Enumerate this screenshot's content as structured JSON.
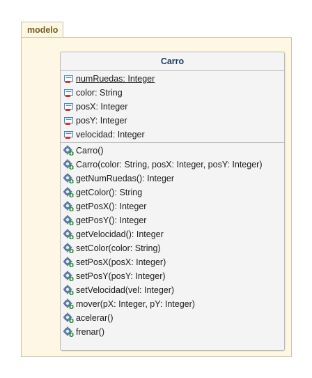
{
  "package": {
    "name": "modelo"
  },
  "class": {
    "name": "Carro",
    "attributes": [
      {
        "text": "numRuedas: Integer",
        "static": true,
        "icon": "private-field-icon"
      },
      {
        "text": "color: String",
        "static": false,
        "icon": "private-field-icon"
      },
      {
        "text": "posX: Integer",
        "static": false,
        "icon": "private-field-icon"
      },
      {
        "text": "posY: Integer",
        "static": false,
        "icon": "private-field-icon"
      },
      {
        "text": "velocidad: Integer",
        "static": false,
        "icon": "private-field-icon"
      }
    ],
    "operations": [
      {
        "text": "Carro()",
        "icon": "public-operation-icon"
      },
      {
        "text": "Carro(color: String, posX: Integer, posY: Integer)",
        "icon": "public-operation-icon"
      },
      {
        "text": "getNumRuedas(): Integer",
        "icon": "public-operation-icon"
      },
      {
        "text": "getColor(): String",
        "icon": "public-operation-icon"
      },
      {
        "text": "getPosX(): Integer",
        "icon": "public-operation-icon"
      },
      {
        "text": "getPosY(): Integer",
        "icon": "public-operation-icon"
      },
      {
        "text": "getVelocidad(): Integer",
        "icon": "public-operation-icon"
      },
      {
        "text": "setColor(color: String)",
        "icon": "public-operation-icon"
      },
      {
        "text": "setPosX(posX: Integer)",
        "icon": "public-operation-icon"
      },
      {
        "text": "setPosY(posY: Integer)",
        "icon": "public-operation-icon"
      },
      {
        "text": "setVelocidad(vel: Integer)",
        "icon": "public-operation-icon"
      },
      {
        "text": "mover(pX: Integer, pY: Integer)",
        "icon": "public-operation-icon"
      },
      {
        "text": "acelerar()",
        "icon": "public-operation-icon"
      },
      {
        "text": "frenar()",
        "icon": "public-operation-icon"
      }
    ]
  },
  "colors": {
    "package_fill": "#fdf7e4",
    "package_label": "#7a5a1c",
    "class_fill": "#f4f4f4",
    "class_name": "#1a3a5c",
    "private_marker": "#d0362f",
    "public_marker": "#2e9a3c"
  }
}
